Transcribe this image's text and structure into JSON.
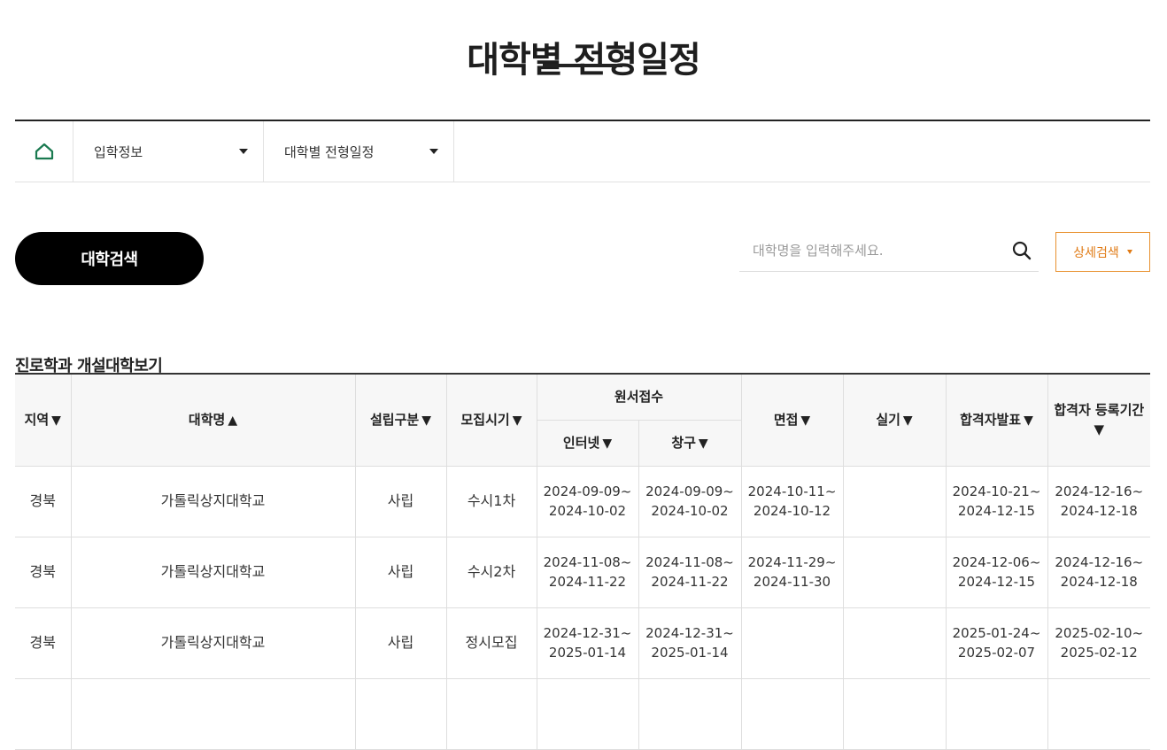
{
  "page": {
    "title": "대학별 전형일정"
  },
  "location": {
    "items": [
      {
        "label": "입학정보"
      },
      {
        "label": "대학별 전형일정"
      }
    ]
  },
  "toolbar": {
    "search_button": "대학검색",
    "search_placeholder": "대학명을 입력해주세요.",
    "detail_button": "상세검색"
  },
  "section": {
    "title": "진로학과 개설대학보기"
  },
  "table": {
    "headers": {
      "region": "지역",
      "university": "대학명",
      "type": "설립구분",
      "period": "모집시기",
      "application": "원서접수",
      "internet": "인터넷",
      "counter": "창구",
      "interview": "면접",
      "practical": "실기",
      "announce": "합격자발표",
      "registration": "합격자 등록기간"
    },
    "sort": {
      "region": "▼",
      "university": "▲",
      "type": "▼",
      "period": "▼",
      "internet": "▼",
      "counter": "▼",
      "interview": "▼",
      "practical": "▼",
      "announce": "▼",
      "registration": "▼"
    },
    "rows": [
      {
        "region": "경북",
        "university": "가톨릭상지대학교",
        "type": "사립",
        "period": "수시1차",
        "internet_from": "2024-09-09~",
        "internet_to": "2024-10-02",
        "counter_from": "2024-09-09~",
        "counter_to": "2024-10-02",
        "interview_from": "2024-10-11~",
        "interview_to": "2024-10-12",
        "practical_from": "",
        "practical_to": "",
        "announce_from": "2024-10-21~",
        "announce_to": "2024-12-15",
        "reg_from": "2024-12-16~",
        "reg_to": "2024-12-18"
      },
      {
        "region": "경북",
        "university": "가톨릭상지대학교",
        "type": "사립",
        "period": "수시2차",
        "internet_from": "2024-11-08~",
        "internet_to": "2024-11-22",
        "counter_from": "2024-11-08~",
        "counter_to": "2024-11-22",
        "interview_from": "2024-11-29~",
        "interview_to": "2024-11-30",
        "practical_from": "",
        "practical_to": "",
        "announce_from": "2024-12-06~",
        "announce_to": "2024-12-15",
        "reg_from": "2024-12-16~",
        "reg_to": "2024-12-18"
      },
      {
        "region": "경북",
        "university": "가톨릭상지대학교",
        "type": "사립",
        "period": "정시모집",
        "internet_from": "2024-12-31~",
        "internet_to": "2025-01-14",
        "counter_from": "2024-12-31~",
        "counter_to": "2025-01-14",
        "interview_from": "",
        "interview_to": "",
        "practical_from": "",
        "practical_to": "",
        "announce_from": "2025-01-24~",
        "announce_to": "2025-02-07",
        "reg_from": "2025-02-10~",
        "reg_to": "2025-02-12"
      },
      {
        "region": "",
        "university": "",
        "type": "",
        "period": "",
        "internet_from": "",
        "internet_to": "",
        "counter_from": "",
        "counter_to": "",
        "interview_from": "",
        "interview_to": "",
        "practical_from": "",
        "practical_to": "",
        "announce_from": "",
        "announce_to": "",
        "reg_from": "",
        "reg_to": ""
      }
    ]
  },
  "colors": {
    "home_icon": "#1a7a50",
    "detail_accent": "#e07a14",
    "search_button_bg": "#000000"
  }
}
